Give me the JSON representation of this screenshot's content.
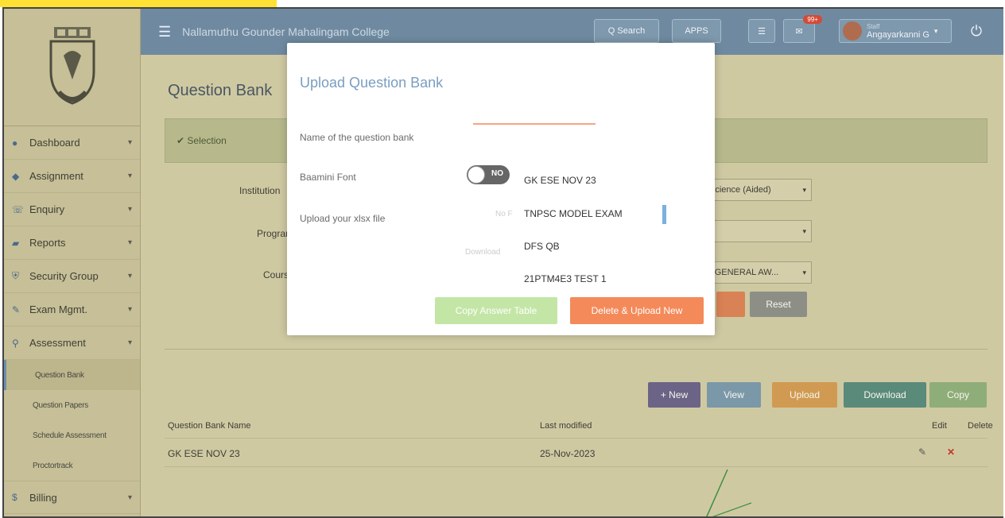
{
  "header": {
    "college_name": "Nallamuthu Gounder Mahalingam College",
    "search_label": "Q Search",
    "apps_label": "APPS",
    "mail_count": "99+",
    "user_role": "Staff",
    "user_name": "Angayarkanni G"
  },
  "sidebar": {
    "items": [
      {
        "label": "Dashboard",
        "icon": "dashboard-icon"
      },
      {
        "label": "Assignment",
        "icon": "assignment-icon"
      },
      {
        "label": "Enquiry",
        "icon": "phone-icon"
      },
      {
        "label": "Reports",
        "icon": "folder-icon"
      },
      {
        "label": "Security Group",
        "icon": "shield-icon"
      },
      {
        "label": "Exam Mgmt.",
        "icon": "edit-icon"
      },
      {
        "label": "Assessment",
        "icon": "search-icon"
      }
    ],
    "sub_items": [
      "Question Bank",
      "Question Papers",
      "Schedule Assessment",
      "Proctortrack"
    ],
    "billing": "Billing"
  },
  "main": {
    "title": "Question Bank",
    "selection": "✔ Selection",
    "institution_label": "Institution",
    "program_label": "Program",
    "course_label": "Course",
    "institution_value": "Science (Aided)",
    "course_value": "- GENERAL AW...",
    "reset_label": "Reset",
    "toolbar": {
      "new": "+ New",
      "view": "View",
      "upload": "Upload",
      "download": "Download",
      "copy": "Copy"
    },
    "table": {
      "headers": [
        "Question Bank Name",
        "Last modified",
        "Edit",
        "Delete"
      ],
      "rows": [
        {
          "name": "GK ESE NOV 23",
          "modified": "25-Nov-2023"
        }
      ]
    }
  },
  "modal": {
    "title": "Upload Question Bank",
    "name_label": "Name of the question bank",
    "font_label": "Baamini Font",
    "toggle_label": "NO",
    "upload_label": "Upload your xlsx file",
    "suggestions": [
      "GK ESE NOV 23",
      "TNPSC MODEL EXAM",
      "DFS QB",
      "21PTM4E3 TEST 1"
    ],
    "faint_choose": "No F",
    "faint_download": "Download",
    "copy_btn": "Copy Answer Table",
    "delete_btn": "Delete & Upload New"
  },
  "colors": {
    "topbar": "#6f8aa0",
    "sidebar": "#c6bf97",
    "modal_title": "#7a9ec0",
    "orange": "#f48a5a",
    "green": "#c3e6a6"
  }
}
